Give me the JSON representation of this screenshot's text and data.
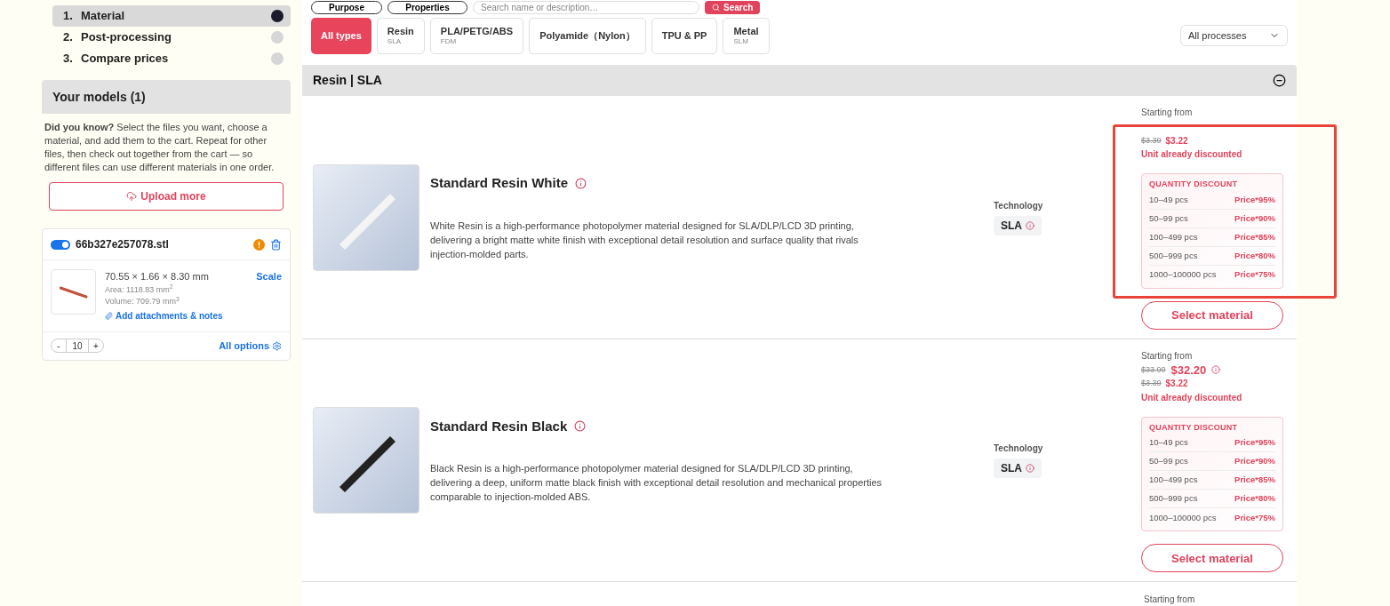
{
  "steps": [
    {
      "number": "1.",
      "label": "Material",
      "selected": true
    },
    {
      "number": "2.",
      "label": "Post-processing",
      "selected": false
    },
    {
      "number": "3.",
      "label": "Compare prices",
      "selected": false
    }
  ],
  "models_panel": {
    "title": "Your models (1)",
    "tip": "**Did you know?** Select the files you want, choose a material, and add them to the cart. Repeat for other files, then check out together from the cart — so different files can use different materials in one order.",
    "upload_button": "Upload more"
  },
  "model": {
    "file_name": "66b327e257078.stl",
    "on": true,
    "dimensions": "70.55 × 1.66 × 8.30 mm",
    "area": "Area: 1118.83 mm$^{2}$",
    "volume": "Volume: 709.79 mm$^{3}$",
    "scale": "Scale",
    "attachments": "Add attachments & notes",
    "quantity": "10",
    "minus": "-",
    "plus": "+",
    "all_options": "All options"
  },
  "top_filters": {
    "purpose": "Purpose",
    "properties": "Properties",
    "search_placeholder": "Search name or description…",
    "search_button": "Search"
  },
  "type_tabs": [
    {
      "label": "All types",
      "selected": true
    },
    {
      "label": "Resin",
      "sub": "SLA",
      "selected": false
    },
    {
      "label": "PLA/PETG/ABS",
      "sub": "FDM",
      "selected": false
    },
    {
      "label": "Polyamide（Nylon）",
      "selected": false
    },
    {
      "label": "TPU & PP",
      "selected": false
    },
    {
      "label": "Metal",
      "sub": "SLM",
      "selected": false
    }
  ],
  "process_select": "All processes",
  "section": {
    "title": "Resin | SLA",
    "expanded": true
  },
  "materials": [
    {
      "name": "Standard Resin White",
      "kind": "white",
      "description": "White Resin is a high-performance photopolymer material designed for SLA/DLP/LCD 3D printing, delivering a bright matte white finish with exceptional detail resolution and surface quality that rivals injection-molded parts.",
      "technology_label": "Technology",
      "technology": "SLA",
      "starting_from": "Starting from",
      "unit_old": "$3.39",
      "unit_new": "$3.22",
      "discount_note": "Unit already discounted",
      "discount_title": "QUANTITY DISCOUNT",
      "tiers": [
        {
          "range": "10–49 pcs",
          "price": "Price*95%"
        },
        {
          "range": "50–99 pcs",
          "price": "Price*90%"
        },
        {
          "range": "100–499 pcs",
          "price": "Price*85%"
        },
        {
          "range": "500–999 pcs",
          "price": "Price*80%"
        },
        {
          "range": "1000–100000 pcs",
          "price": "Price*75%"
        }
      ],
      "button": "Select material",
      "highlighted": true
    },
    {
      "name": "Standard Resin Black",
      "kind": "black",
      "description": "Black Resin is a high-performance photopolymer material designed for SLA/DLP/LCD 3D printing, delivering a deep, uniform matte black finish with exceptional detail resolution and mechanical properties comparable to injection-molded ABS.",
      "technology_label": "Technology",
      "technology": "SLA",
      "starting_from": "Starting from",
      "price_old": "$33.90",
      "price_new": "$32.20",
      "unit_old": "$3.39",
      "unit_new": "$3.22",
      "discount_note": "Unit already discounted",
      "discount_title": "QUANTITY DISCOUNT",
      "tiers": [
        {
          "range": "10–49 pcs",
          "price": "Price*95%"
        },
        {
          "range": "50–99 pcs",
          "price": "Price*90%"
        },
        {
          "range": "100–499 pcs",
          "price": "Price*85%"
        },
        {
          "range": "500–999 pcs",
          "price": "Price*80%"
        },
        {
          "range": "1000–100000 pcs",
          "price": "Price*75%"
        }
      ],
      "button": "Select material",
      "highlighted": false
    }
  ],
  "next_item": {
    "starting_from": "Starting from"
  }
}
